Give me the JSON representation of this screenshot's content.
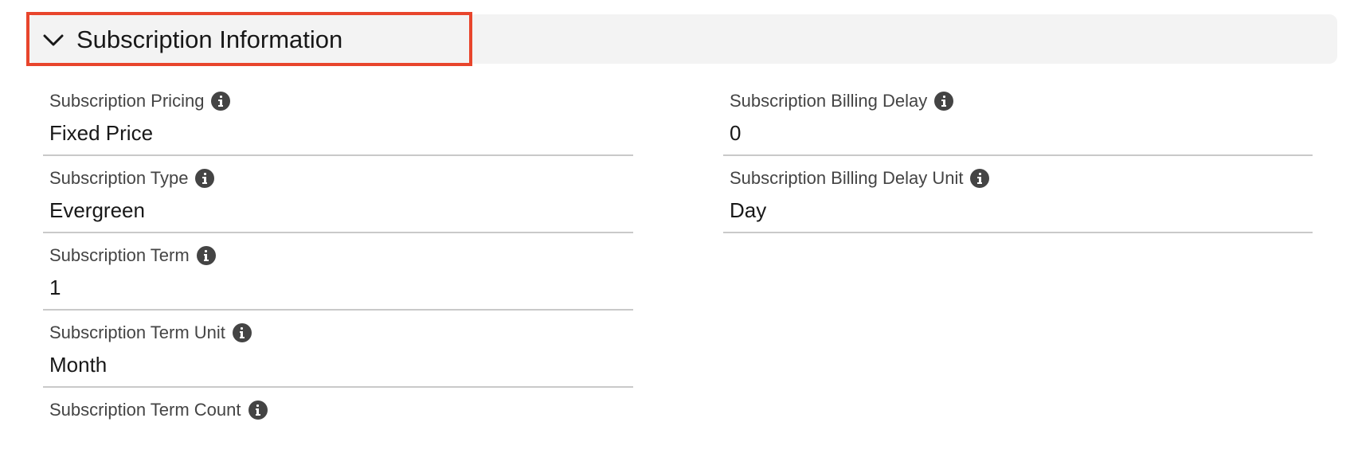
{
  "section": {
    "title": "Subscription Information",
    "expanded": true,
    "toggle_icon": "chevron-down-icon",
    "highlight_color": "#e8452c"
  },
  "fields": {
    "left": [
      {
        "label": "Subscription Pricing",
        "value": "Fixed Price",
        "help_icon": "info-icon"
      },
      {
        "label": "Subscription Type",
        "value": "Evergreen",
        "help_icon": "info-icon"
      },
      {
        "label": "Subscription Term",
        "value": "1",
        "help_icon": "info-icon"
      },
      {
        "label": "Subscription Term Unit",
        "value": "Month",
        "help_icon": "info-icon"
      },
      {
        "label": "Subscription Term Count",
        "value": "",
        "help_icon": "info-icon"
      }
    ],
    "right": [
      {
        "label": "Subscription Billing Delay",
        "value": "0",
        "help_icon": "info-icon"
      },
      {
        "label": "Subscription Billing Delay Unit",
        "value": "Day",
        "help_icon": "info-icon"
      }
    ]
  }
}
